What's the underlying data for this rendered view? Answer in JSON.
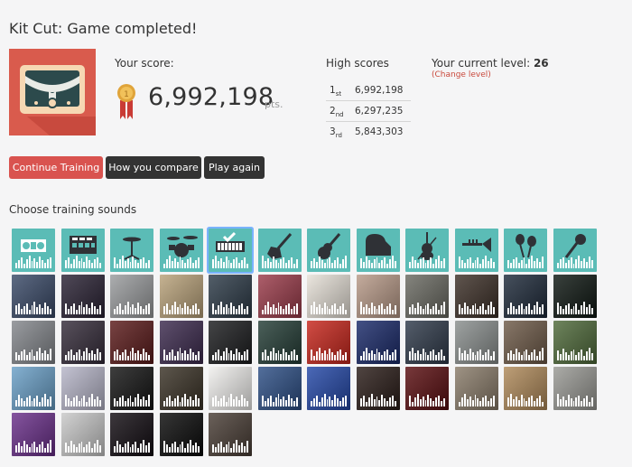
{
  "header": {
    "title": "Kit Cut: Game completed!"
  },
  "score": {
    "label": "Your score:",
    "value": "6,992,198",
    "unit": "pts."
  },
  "high_scores": {
    "title": "High scores",
    "rows": [
      {
        "rank": "1",
        "suffix": "st",
        "score": "6,992,198"
      },
      {
        "rank": "2",
        "suffix": "nd",
        "score": "6,297,235"
      },
      {
        "rank": "3",
        "suffix": "rd",
        "score": "5,843,303"
      }
    ]
  },
  "level": {
    "label": "Your current level:",
    "value": "26",
    "change_label": "(Change level)"
  },
  "buttons": {
    "continue": "Continue Training",
    "compare": "How you compare",
    "play_again": "Play again"
  },
  "sounds": {
    "title": "Choose training sounds",
    "selected_index": 4,
    "tiles": [
      {
        "kind": "icon",
        "icon": "speakers-icon",
        "bg": "#5bbcb6"
      },
      {
        "kind": "icon",
        "icon": "drum-machine-icon",
        "bg": "#5bbcb6"
      },
      {
        "kind": "icon",
        "icon": "hihat-icon",
        "bg": "#5bbcb6"
      },
      {
        "kind": "icon",
        "icon": "drum-kit-icon",
        "bg": "#5bbcb6"
      },
      {
        "kind": "icon",
        "icon": "keyboard-icon",
        "bg": "#5bbcb6"
      },
      {
        "kind": "icon",
        "icon": "electric-guitar-icon",
        "bg": "#5bbcb6"
      },
      {
        "kind": "icon",
        "icon": "acoustic-guitar-icon",
        "bg": "#5bbcb6"
      },
      {
        "kind": "icon",
        "icon": "piano-icon",
        "bg": "#5bbcb6"
      },
      {
        "kind": "icon",
        "icon": "violin-icon",
        "bg": "#5bbcb6"
      },
      {
        "kind": "icon",
        "icon": "trumpet-icon",
        "bg": "#5bbcb6"
      },
      {
        "kind": "icon",
        "icon": "maracas-icon",
        "bg": "#5bbcb6"
      },
      {
        "kind": "icon",
        "icon": "microphone-icon",
        "bg": "#5bbcb6"
      },
      {
        "kind": "photo",
        "bg": "#3a4a68"
      },
      {
        "kind": "photo",
        "bg": "#2a2234"
      },
      {
        "kind": "photo",
        "bg": "#9a9c9e"
      },
      {
        "kind": "photo",
        "bg": "#b9a27a"
      },
      {
        "kind": "photo",
        "bg": "#2d3b48"
      },
      {
        "kind": "photo",
        "bg": "#9b3b4a"
      },
      {
        "kind": "photo",
        "bg": "#e7e1d8"
      },
      {
        "kind": "photo",
        "bg": "#b89a88"
      },
      {
        "kind": "photo",
        "bg": "#6a6a62"
      },
      {
        "kind": "photo",
        "bg": "#3d3028"
      },
      {
        "kind": "photo",
        "bg": "#1e2a3a"
      },
      {
        "kind": "photo",
        "bg": "#0e1712"
      },
      {
        "kind": "photo",
        "bg": "#84878c"
      },
      {
        "kind": "photo",
        "bg": "#352c3a"
      },
      {
        "kind": "photo",
        "bg": "#5b1a1a"
      },
      {
        "kind": "photo",
        "bg": "#3c2a4e"
      },
      {
        "kind": "photo",
        "bg": "#1b1c1e"
      },
      {
        "kind": "photo",
        "bg": "#243d36"
      },
      {
        "kind": "photo",
        "bg": "#c8261c"
      },
      {
        "kind": "photo",
        "bg": "#1a2a6a"
      },
      {
        "kind": "photo",
        "bg": "#2f3a4a"
      },
      {
        "kind": "photo",
        "bg": "#8a8f8e"
      },
      {
        "kind": "photo",
        "bg": "#6e5a48"
      },
      {
        "kind": "photo",
        "bg": "#4f6a3a"
      },
      {
        "kind": "photo",
        "bg": "#6aa0c8"
      },
      {
        "kind": "photo",
        "bg": "#b7b6c9"
      },
      {
        "kind": "photo",
        "bg": "#141414"
      },
      {
        "kind": "photo",
        "bg": "#3a3226"
      },
      {
        "kind": "photo",
        "bg": "#f1f0ee"
      },
      {
        "kind": "photo",
        "bg": "#2d4f86"
      },
      {
        "kind": "photo",
        "bg": "#2448a8"
      },
      {
        "kind": "photo",
        "bg": "#2a1c18"
      },
      {
        "kind": "photo",
        "bg": "#5a0d10"
      },
      {
        "kind": "photo",
        "bg": "#8a7c6a"
      },
      {
        "kind": "photo",
        "bg": "#b08a5a"
      },
      {
        "kind": "photo",
        "bg": "#9a9a95"
      },
      {
        "kind": "photo",
        "bg": "#6a2f8a"
      },
      {
        "kind": "photo",
        "bg": "#c9c9c9"
      },
      {
        "kind": "photo",
        "bg": "#120c12"
      },
      {
        "kind": "photo",
        "bg": "#0a0a0a"
      },
      {
        "kind": "photo",
        "bg": "#4a3e36"
      }
    ]
  }
}
